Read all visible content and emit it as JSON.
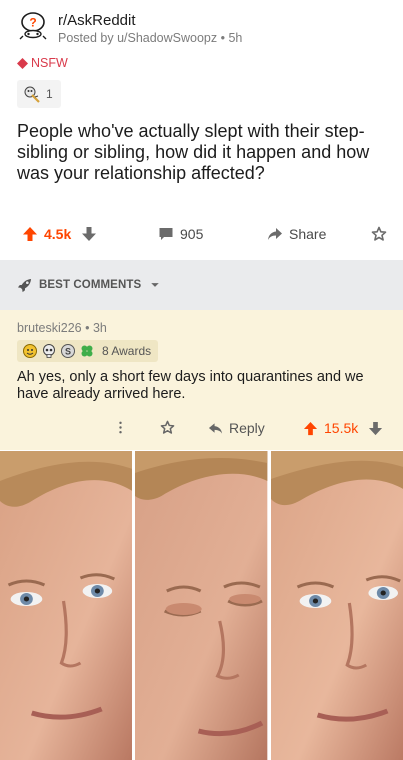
{
  "post": {
    "subreddit": "r/AskReddit",
    "posted_by": "Posted by u/ShadowSwoopz • 5h",
    "nsfw_label": "NSFW",
    "award_count": "1",
    "title": "People who've actually slept with their step-sibling or sibling, how did it happen and how was your relationship affected?"
  },
  "actions": {
    "score": "4.5k",
    "comments": "905",
    "share_label": "Share"
  },
  "sort": {
    "label": "BEST COMMENTS"
  },
  "comment": {
    "meta": "bruteski226 • 3h",
    "awards_label": "8 Awards",
    "body": "Ah yes, only a short few days into quarantines and we have already arrived here.",
    "reply_label": "Reply",
    "score": "15.5k"
  },
  "colors": {
    "upvote": "#ff4500",
    "nsfw": "#d93a4b",
    "comment_highlight": "#faf3dc",
    "sort_bar": "#eaebed"
  },
  "icons": {
    "subreddit": "askreddit-snoo-icon",
    "nsfw": "diamond-icon",
    "upvote": "up-arrow-icon",
    "downvote": "down-arrow-icon",
    "comment": "speech-bubble-icon",
    "share": "share-arrow-icon",
    "save": "star-icon",
    "sort": "rocket-icon",
    "more": "vertical-dots-icon",
    "reply": "reply-arrow-icon"
  }
}
